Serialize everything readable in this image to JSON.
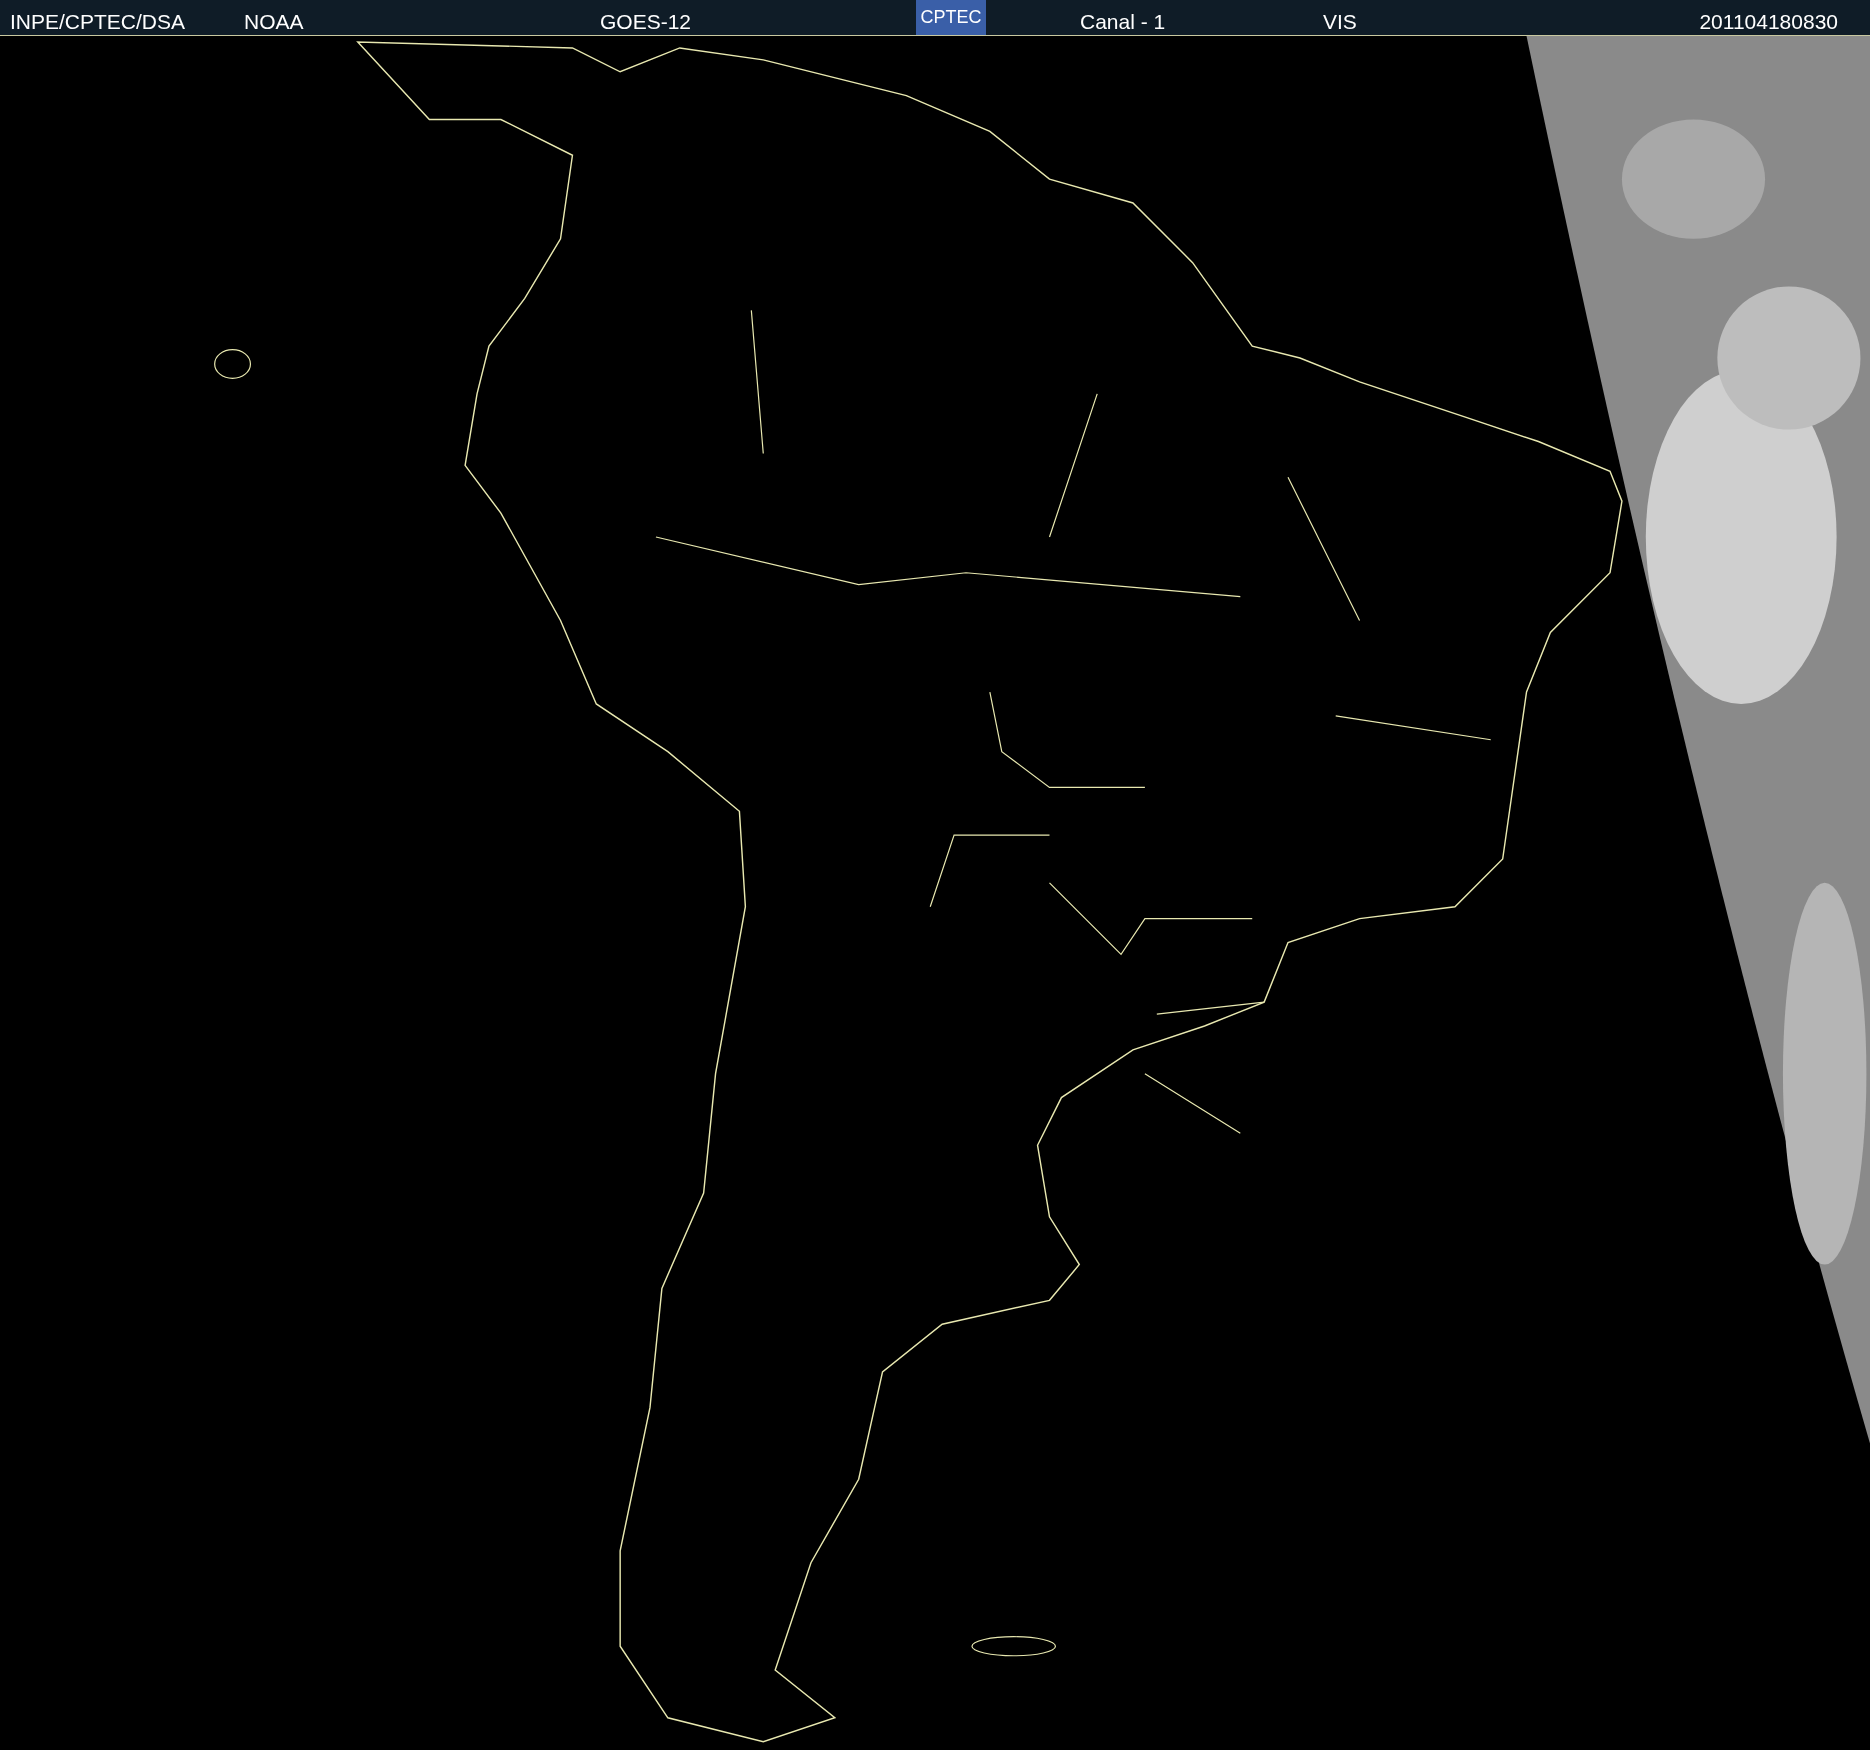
{
  "header": {
    "labels": [
      {
        "text": "INPE/CPTEC/DSA"
      },
      {
        "text": "NOAA"
      },
      {
        "text": "GOES-12"
      }
    ],
    "logo": "CPTEC",
    "labels_right": [
      {
        "text": "Canal - 1"
      },
      {
        "text": "VIS"
      }
    ],
    "timestamp": "201104180830"
  }
}
